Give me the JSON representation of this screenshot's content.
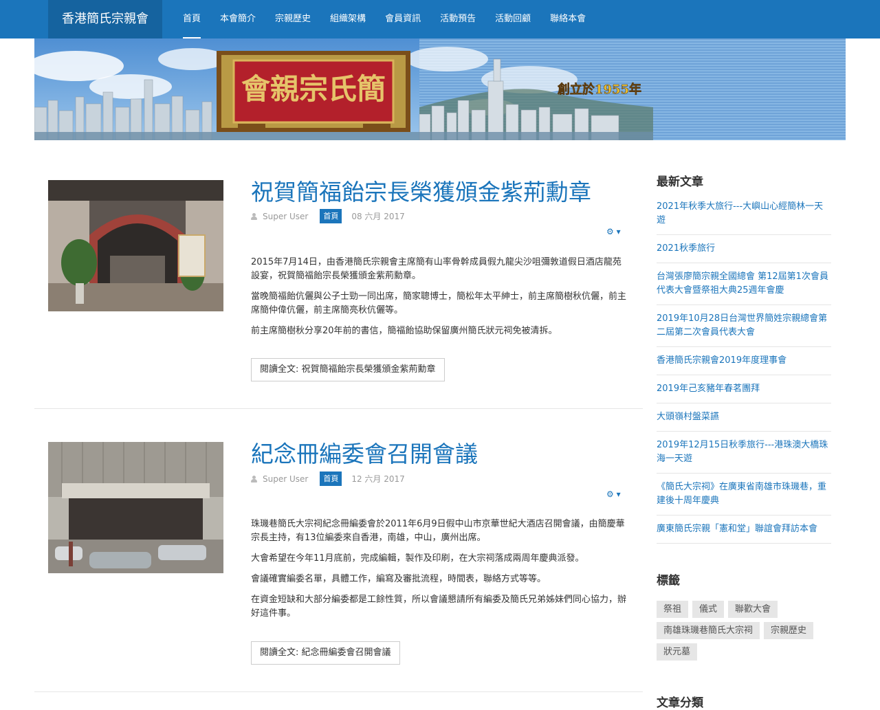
{
  "nav": {
    "brand": "香港簡氏宗親會",
    "items": [
      {
        "label": "首頁",
        "active": true
      },
      {
        "label": "本會簡介"
      },
      {
        "label": "宗親歷史"
      },
      {
        "label": "組織架構"
      },
      {
        "label": "會員資訊"
      },
      {
        "label": "活動預告"
      },
      {
        "label": "活動回顧"
      },
      {
        "label": "聯絡本會"
      }
    ]
  },
  "banner": {
    "plaque": "會親宗氏簡",
    "founded": "創立於1955年"
  },
  "articles": [
    {
      "title": "祝賀簡福飴宗長榮獲頒金紫荊勳章",
      "author": "Super User",
      "category": "首頁",
      "date": "08 六月 2017",
      "paragraphs": [
        "2015年7月14日，由香港簡氏宗親會主席簡有山率骨幹成員假九龍尖沙咀彌敦道假日酒店龍苑設宴，祝賀簡福飴宗長榮獲頒金紫荊勳章。",
        "當晚簡福飴伉儷與公子士勁一同出席，簡家聰博士，簡松年太平紳士，前主席簡樹秋伉儷，前主席簡仲偉伉儷，前主席簡亮秋伉儷等。",
        "前主席簡樹秋分享20年前的書信，簡福飴協助保留廣州簡氏狀元祠免被清拆。"
      ],
      "readmore": "閱讀全文: 祝賀簡福飴宗長榮獲頒金紫荊勳章"
    },
    {
      "title": "紀念冊編委會召開會議",
      "author": "Super User",
      "category": "首頁",
      "date": "12 六月 2017",
      "paragraphs": [
        "珠璣巷簡氏大宗祠紀念冊編委會於2011年6月9日假中山市京華世紀大酒店召開會議，由簡慶華宗長主持，有13位編委來自香港，南雄，中山，廣州出席。",
        "大會希望在今年11月底前，完成編輯，製作及印刷，在大宗祠落成兩周年慶典派發。",
        "會議確實編委名單，具體工作，編寫及審批流程，時間表，聯絡方式等等。",
        "在資金短缺和大部分編委都是工餘性質，所以會議懇請所有編委及簡氏兄弟姊妹們同心協力，辦好這件事。"
      ],
      "readmore": "閱讀全文: 紀念冊編委會召開會議"
    }
  ],
  "sidebar": {
    "latest_title": "最新文章",
    "latest": [
      "2021年秋季大旅行---大嶼山心經簡林一天遊",
      "2021秋季旅行",
      "台灣張廖簡宗親全國總會 第12屆第1次會員代表大會暨祭祖大典25週年會慶",
      "2019年10月28日台灣世界簡姓宗親總會第二屆第二次會員代表大會",
      "香港簡氏宗親會2019年度理事會",
      "2019年己亥豬年春茗團拜",
      "大頭嶺村盤菜讌",
      "2019年12月15日秋季旅行---港珠澳大橋珠海一天遊",
      "《簡氏大宗祠》在廣東省南雄市珠璣巷，重建後十周年慶典",
      "廣東簡氏宗親「憲和堂」聯誼會拜訪本會"
    ],
    "tags_title": "標籤",
    "tags": [
      "祭祖",
      "儀式",
      "聯歡大會",
      "南雄珠璣巷簡氏大宗祠",
      "宗親歷史",
      "狀元墓"
    ],
    "categories_title": "文章分類"
  },
  "colors": {
    "primary": "#1b75bb",
    "brand_bg": "#15639f"
  }
}
